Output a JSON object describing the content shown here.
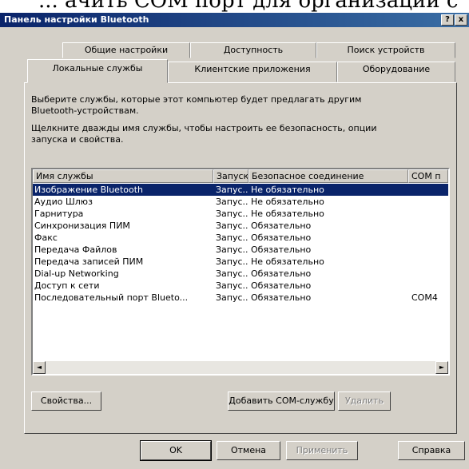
{
  "caption_fragment": "... ачить COM порт для организации с",
  "window": {
    "title": "Панель настройки Bluetooth",
    "help_button": "?",
    "close_button": "x"
  },
  "tabs_back": [
    "Общие настройки",
    "Доступность",
    "Поиск устройств"
  ],
  "tabs_front": [
    "Локальные службы",
    "Клиентские приложения",
    "Оборудование"
  ],
  "active_tab": "Локальные службы",
  "description": {
    "line1": "Выберите службы, которые этот компьютер будет предлагать другим",
    "line2": "Bluetooth-устройствам.",
    "line3": "Щелкните дважды имя службы, чтобы настроить ее безопасность, опции",
    "line4": "запуска и свойства."
  },
  "columns": [
    "Имя службы",
    "Запуск",
    "Безопасное соединение",
    "COM п"
  ],
  "rows": [
    {
      "name": "Изображение Bluetooth",
      "start": "Запус...",
      "secure": "Не обязательно",
      "com": ""
    },
    {
      "name": "Аудио Шлюз",
      "start": "Запус...",
      "secure": "Не обязательно",
      "com": ""
    },
    {
      "name": "Гарнитура",
      "start": "Запус...",
      "secure": "Не обязательно",
      "com": ""
    },
    {
      "name": "Синхронизация ПИМ",
      "start": "Запус...",
      "secure": "Обязательно",
      "com": ""
    },
    {
      "name": "Факс",
      "start": "Запус...",
      "secure": "Обязательно",
      "com": ""
    },
    {
      "name": "Передача Файлов",
      "start": "Запус...",
      "secure": "Обязательно",
      "com": ""
    },
    {
      "name": "Передача записей ПИМ",
      "start": "Запус...",
      "secure": "Не обязательно",
      "com": ""
    },
    {
      "name": "Dial-up Networking",
      "start": "Запус...",
      "secure": "Обязательно",
      "com": ""
    },
    {
      "name": "Доступ к сети",
      "start": "Запус...",
      "secure": "Обязательно",
      "com": ""
    },
    {
      "name": "Последовательный порт Blueto...",
      "start": "Запус...",
      "secure": "Обязательно",
      "com": "COM4"
    }
  ],
  "selected_row": 0,
  "buttons": {
    "properties": "Свойства...",
    "add_com": "Добавить COM-службу",
    "delete": "Удалить",
    "ok": "OK",
    "cancel": "Отмена",
    "apply": "Применить",
    "help": "Справка"
  },
  "scroll_left": "◄",
  "scroll_right": "►"
}
